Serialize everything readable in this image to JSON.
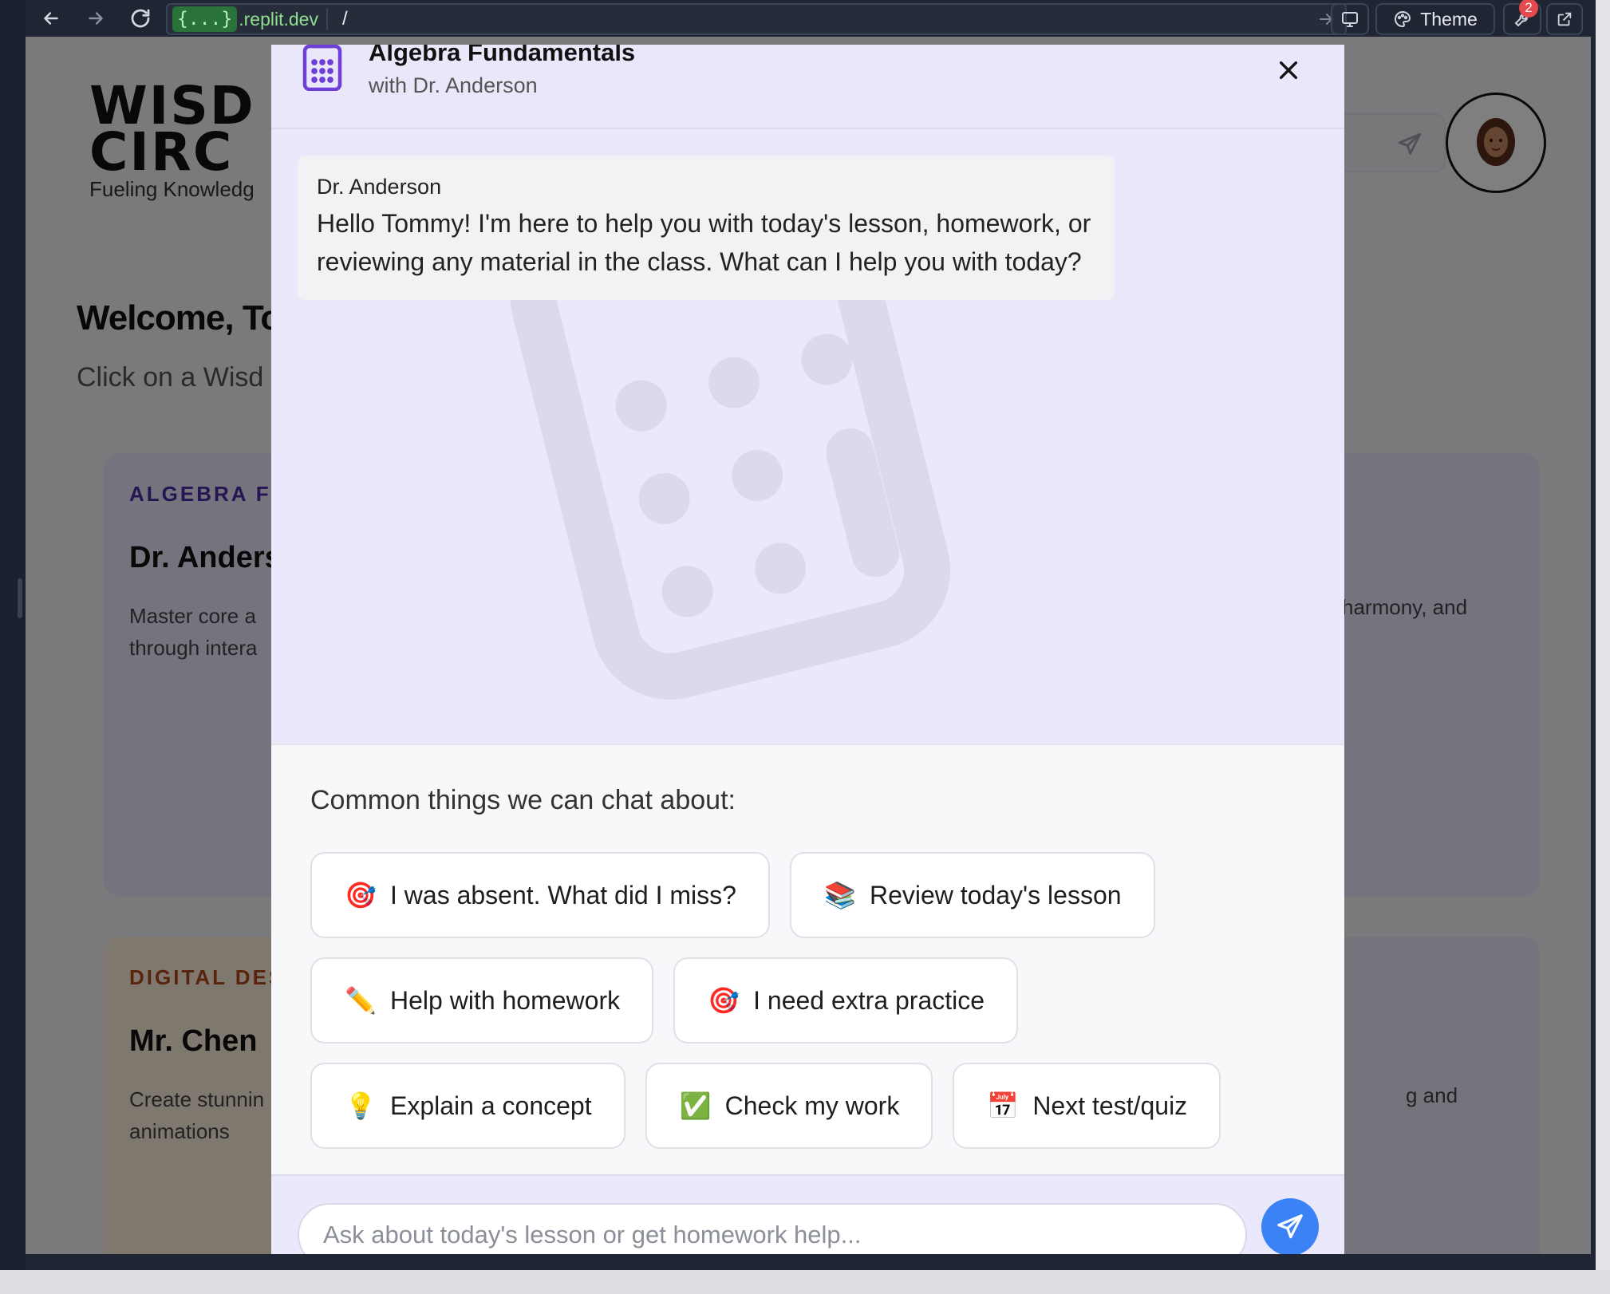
{
  "browser": {
    "url_chip": "{...}",
    "url_domain": ".replit.dev",
    "url_path": "/",
    "theme_label": "Theme",
    "notification_count": "2"
  },
  "background_page": {
    "logo_line1": "WISD",
    "logo_line2": "CIRC",
    "tagline": "Fueling Knowledg",
    "welcome": "Welcome, To",
    "click_hint": "Click on a Wisd",
    "cards": [
      {
        "subject": "ALGEBRA FU",
        "teacher": "Dr. Anders",
        "desc_line1": "Master core a",
        "desc_line2": "through intera",
        "subject_color": "#4b2aa5"
      },
      {
        "subject": "DIGITAL DES",
        "teacher": "Mr. Chen",
        "desc_line1": "Create stunnin",
        "desc_line2": "animations",
        "subject_color": "#b5461a"
      }
    ],
    "right_card_text": "harmony, and",
    "right_card_text2": "g and"
  },
  "modal": {
    "title": "Algebra Fundamentals",
    "subtitle": "with Dr. Anderson",
    "accent_color": "#6d3fd8",
    "message": {
      "sender": "Dr. Anderson",
      "text": "Hello Tommy! I'm here to help you with today's lesson, homework, or reviewing any material in the class. What can I help you with today?"
    },
    "suggestions_title": "Common things we can chat about:",
    "suggestion_rows": [
      [
        {
          "emoji": "🎯",
          "label": "I was absent. What did I miss?"
        },
        {
          "emoji": "📚",
          "label": "Review today's lesson"
        }
      ],
      [
        {
          "emoji": "✏️",
          "label": "Help with homework"
        },
        {
          "emoji": "🎯",
          "label": "I need extra practice"
        }
      ],
      [
        {
          "emoji": "💡",
          "label": "Explain a concept"
        },
        {
          "emoji": "✅",
          "label": "Check my work"
        },
        {
          "emoji": "📅",
          "label": "Next test/quiz"
        }
      ]
    ],
    "input_placeholder": "Ask about today's lesson or get homework help...",
    "send_color": "#3b82f6"
  }
}
